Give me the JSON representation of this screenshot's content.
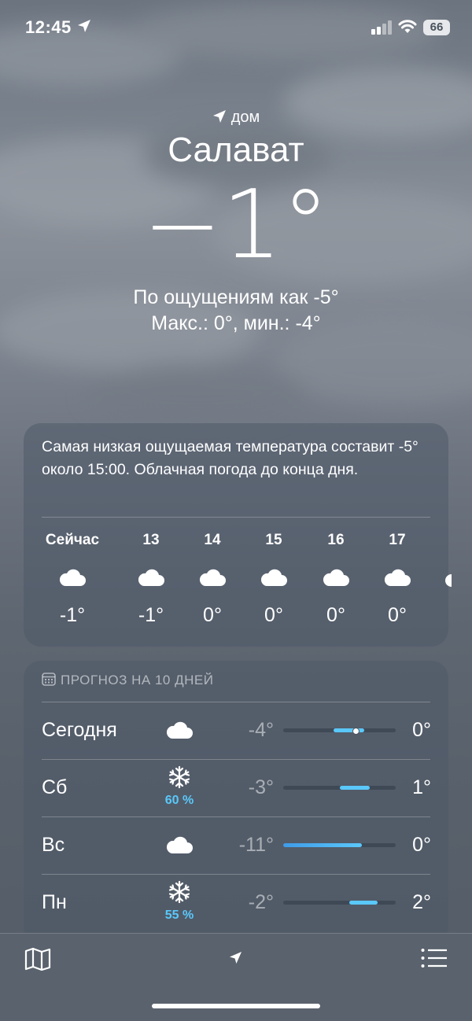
{
  "status_bar": {
    "time": "12:45",
    "battery": "66"
  },
  "location": {
    "label": "дом",
    "city": "Салават"
  },
  "current": {
    "temperature": "−1°",
    "feels_like": "По ощущениям как -5°",
    "high_low": "Макс.: 0°, мин.: -4°"
  },
  "hourly": {
    "summary": "Самая низкая ощущаемая температура составит -5° около 15:00. Облачная погода до конца дня.",
    "hours": [
      {
        "label": "Сейчас",
        "icon": "cloud-icon",
        "temp": "-1°"
      },
      {
        "label": "13",
        "icon": "cloud-icon",
        "temp": "-1°"
      },
      {
        "label": "14",
        "icon": "cloud-icon",
        "temp": "0°"
      },
      {
        "label": "15",
        "icon": "cloud-icon",
        "temp": "0°"
      },
      {
        "label": "16",
        "icon": "cloud-icon",
        "temp": "0°"
      },
      {
        "label": "17",
        "icon": "cloud-icon",
        "temp": "0°"
      }
    ]
  },
  "forecast": {
    "title": "ПРОГНОЗ НА 10 ДНЕЙ",
    "days": [
      {
        "name": "Сегодня",
        "icon": "cloud-icon",
        "precip": "",
        "low": "-4°",
        "high": "0°",
        "range": [
          0.45,
          0.72
        ],
        "current_marker": 0.64
      },
      {
        "name": "Сб",
        "icon": "snowflake-icon",
        "precip": "60 %",
        "low": "-3°",
        "high": "1°",
        "range": [
          0.5,
          0.77
        ]
      },
      {
        "name": "Вс",
        "icon": "cloud-icon",
        "precip": "",
        "low": "-11°",
        "high": "0°",
        "range": [
          0.0,
          0.7
        ]
      },
      {
        "name": "Пн",
        "icon": "snowflake-icon",
        "precip": "55 %",
        "low": "-2°",
        "high": "2°",
        "range": [
          0.59,
          0.84
        ]
      }
    ]
  },
  "colors": {
    "bar_cool": "#5ac8fa",
    "bar_blue": "#3f9be8"
  },
  "tab_bar": {
    "icons": [
      "map-icon",
      "location-arrow-icon",
      "list-icon"
    ]
  }
}
